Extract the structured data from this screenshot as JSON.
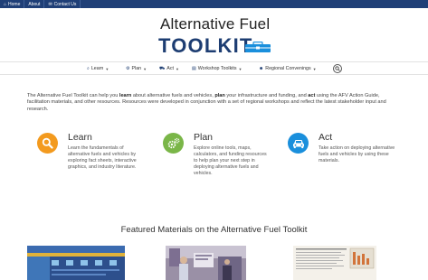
{
  "topbar": {
    "links": [
      {
        "icon": "home-icon",
        "glyph": "⌂",
        "label": "Home"
      },
      {
        "icon": "info-icon",
        "glyph": "",
        "label": "About"
      },
      {
        "icon": "envelope-icon",
        "glyph": "✉",
        "label": "Contact Us"
      }
    ]
  },
  "logo": {
    "line1": "Alternative Fuel",
    "line2": "TOOLKIT"
  },
  "nav": {
    "items": [
      {
        "icon": "search-icon",
        "glyph": "⌕",
        "label": "Learn"
      },
      {
        "icon": "gears-icon",
        "glyph": "⚙",
        "label": "Plan"
      },
      {
        "icon": "car-icon",
        "glyph": "⛟",
        "label": "Act"
      },
      {
        "icon": "clipboard-icon",
        "glyph": "▤",
        "label": "Workshop Toolkits"
      },
      {
        "icon": "group-icon",
        "glyph": "☻",
        "label": "Regional Convenings"
      }
    ]
  },
  "intro": {
    "p1": "The Alternative Fuel Toolkit can help you ",
    "b1": "learn",
    "p2": " about alternative fuels and vehicles, ",
    "b2": "plan",
    "p3": " your infrastructure and funding, and ",
    "b3": "act",
    "p4": " using the AFV Action Guide, facilitation materials, and other resources. Resources were developed in conjunction with a set of regional workshops and reflect the latest stakeholder input and research."
  },
  "features": [
    {
      "title": "Learn",
      "desc": "Learn the fundamentals of alternative fuels and vehicles by exploring fact sheets, interactive graphics, and industry literature.",
      "color": "#f39a1e"
    },
    {
      "title": "Plan",
      "desc": "Explore online tools, maps, calculators, and funding resources to help plan your next step in deploying alternative fuels and vehicles.",
      "color": "#7ab648"
    },
    {
      "title": "Act",
      "desc": "Take action on deploying alternative fuels and vehicles by using these materials.",
      "color": "#1a8fdc"
    }
  ],
  "featured": {
    "title": "Featured Materials on the Alternative Fuel Toolkit"
  }
}
